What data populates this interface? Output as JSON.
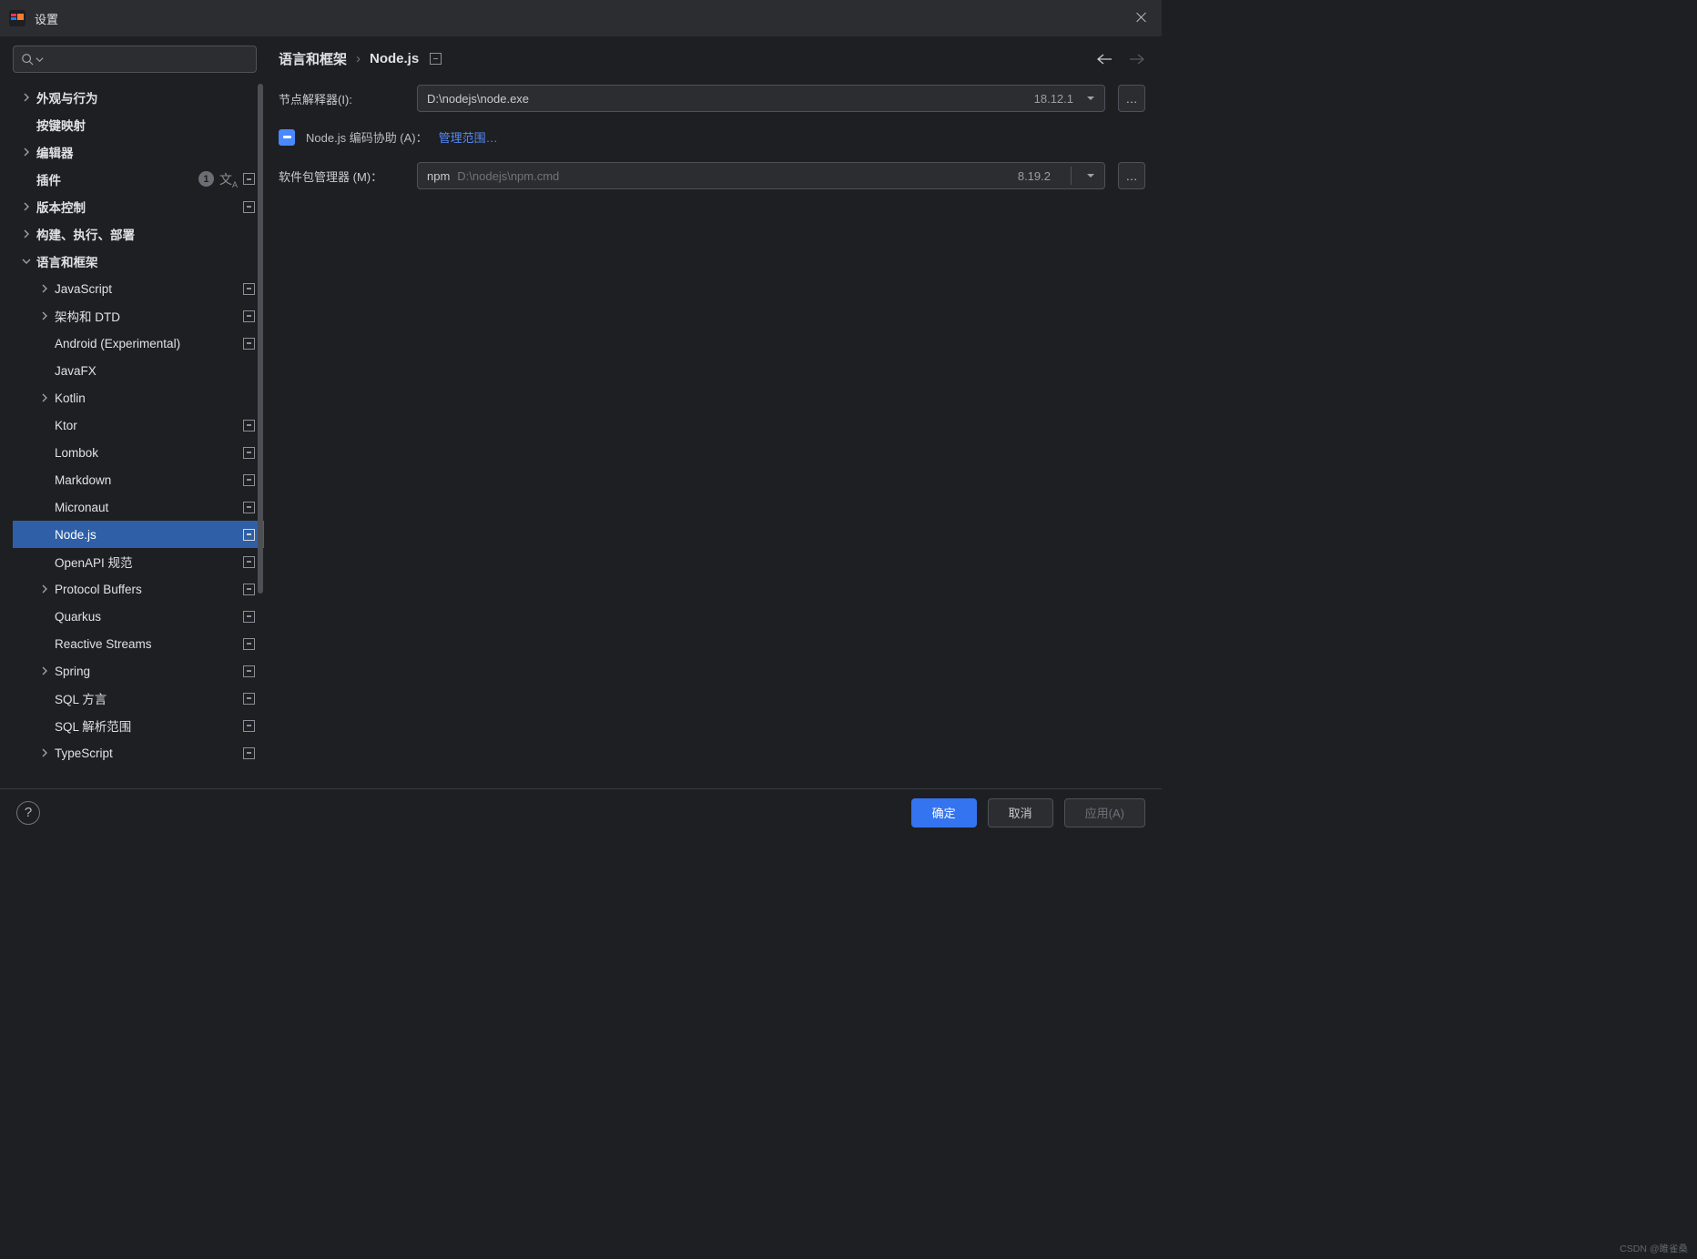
{
  "title": "设置",
  "breadcrumb": {
    "parent": "语言和框架",
    "sep": "›",
    "current": "Node.js"
  },
  "nav": {
    "back_enabled": true,
    "forward_enabled": false
  },
  "sidebar": {
    "items": [
      {
        "label": "外观与行为",
        "indent": 0,
        "chev": "right",
        "bold": true
      },
      {
        "label": "按键映射",
        "indent": 0,
        "chev": "none",
        "bold": true
      },
      {
        "label": "编辑器",
        "indent": 0,
        "chev": "right",
        "bold": true
      },
      {
        "label": "插件",
        "indent": 0,
        "chev": "none",
        "bold": true,
        "badge": "1",
        "lang": true,
        "proj": true
      },
      {
        "label": "版本控制",
        "indent": 0,
        "chev": "right",
        "bold": true,
        "proj": true
      },
      {
        "label": "构建、执行、部署",
        "indent": 0,
        "chev": "right",
        "bold": true
      },
      {
        "label": "语言和框架",
        "indent": 0,
        "chev": "down",
        "bold": true
      },
      {
        "label": "JavaScript",
        "indent": 1,
        "chev": "right",
        "proj": true
      },
      {
        "label": "架构和 DTD",
        "indent": 1,
        "chev": "right",
        "proj": true
      },
      {
        "label": "Android (Experimental)",
        "indent": 1,
        "chev": "none",
        "proj": true
      },
      {
        "label": "JavaFX",
        "indent": 1,
        "chev": "none"
      },
      {
        "label": "Kotlin",
        "indent": 1,
        "chev": "right"
      },
      {
        "label": "Ktor",
        "indent": 1,
        "chev": "none",
        "proj": true
      },
      {
        "label": "Lombok",
        "indent": 1,
        "chev": "none",
        "proj": true
      },
      {
        "label": "Markdown",
        "indent": 1,
        "chev": "none",
        "proj": true
      },
      {
        "label": "Micronaut",
        "indent": 1,
        "chev": "none",
        "proj": true
      },
      {
        "label": "Node.js",
        "indent": 1,
        "chev": "none",
        "proj": true,
        "selected": true
      },
      {
        "label": "OpenAPI 规范",
        "indent": 1,
        "chev": "none",
        "proj": true
      },
      {
        "label": "Protocol Buffers",
        "indent": 1,
        "chev": "right",
        "proj": true
      },
      {
        "label": "Quarkus",
        "indent": 1,
        "chev": "none",
        "proj": true
      },
      {
        "label": "Reactive Streams",
        "indent": 1,
        "chev": "none",
        "proj": true
      },
      {
        "label": "Spring",
        "indent": 1,
        "chev": "right",
        "proj": true
      },
      {
        "label": "SQL 方言",
        "indent": 1,
        "chev": "none",
        "proj": true
      },
      {
        "label": "SQL 解析范围",
        "indent": 1,
        "chev": "none",
        "proj": true
      },
      {
        "label": "TypeScript",
        "indent": 1,
        "chev": "right",
        "proj": true
      }
    ]
  },
  "form": {
    "interpreter": {
      "label": "节点解释器(I):",
      "value": "D:\\nodejs\\node.exe",
      "version": "18.12.1"
    },
    "coding_assist": {
      "label": "Node.js 编码协助 (A)：",
      "link": "管理范围…"
    },
    "pkg_manager": {
      "label": "软件包管理器 (M)：",
      "kind": "npm",
      "path": "D:\\nodejs\\npm.cmd",
      "version": "8.19.2"
    }
  },
  "footer": {
    "ok": "确定",
    "cancel": "取消",
    "apply": "应用(A)"
  },
  "watermark": "CSDN @雎雀桑"
}
